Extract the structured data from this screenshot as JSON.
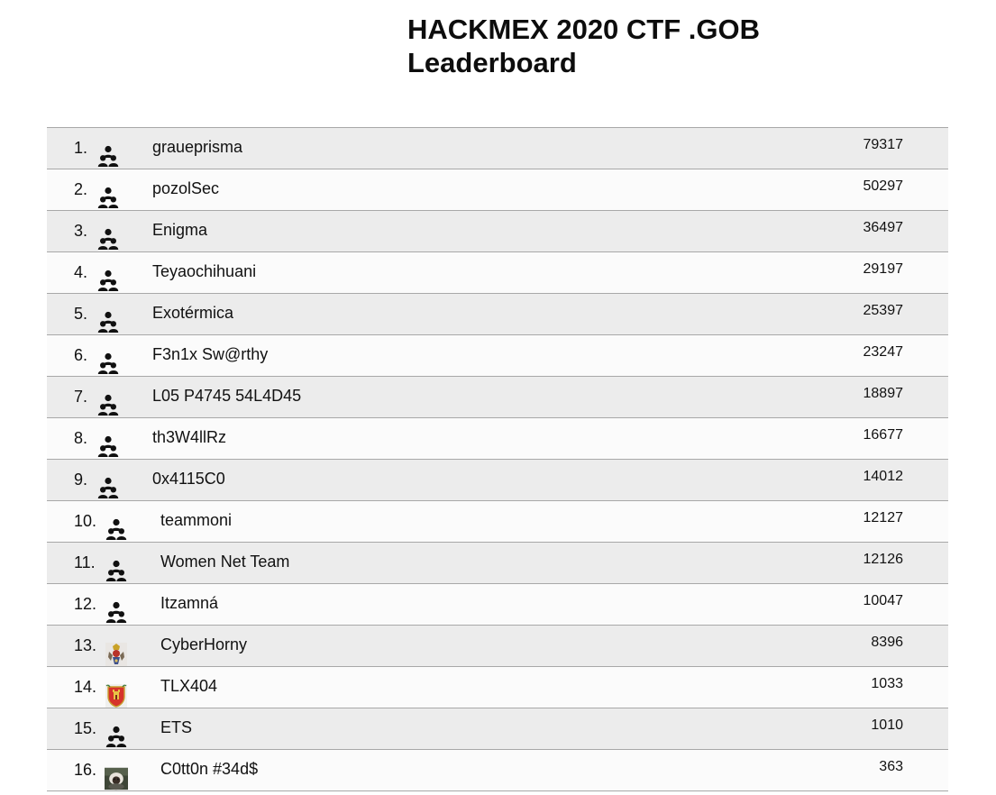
{
  "page": {
    "title_line1": "HACKMEX 2020 CTF .GOB",
    "title_line2": "Leaderboard"
  },
  "leaderboard": {
    "rows": [
      {
        "rank": "1.",
        "name": "graueprisma",
        "score": "79317",
        "avatar": "group-icon"
      },
      {
        "rank": "2.",
        "name": "pozolSec",
        "score": "50297",
        "avatar": "group-icon"
      },
      {
        "rank": "3.",
        "name": "Enigma",
        "score": "36497",
        "avatar": "group-icon"
      },
      {
        "rank": "4.",
        "name": "Teyaochihuani",
        "score": "29197",
        "avatar": "group-icon"
      },
      {
        "rank": "5.",
        "name": "Exotérmica",
        "score": "25397",
        "avatar": "group-icon"
      },
      {
        "rank": "6.",
        "name": "F3n1x Sw@rthy",
        "score": "23247",
        "avatar": "group-icon"
      },
      {
        "rank": "7.",
        "name": "L05 P4745 54L4D45",
        "score": "18897",
        "avatar": "group-icon"
      },
      {
        "rank": "8.",
        "name": "th3W4llRz",
        "score": "16677",
        "avatar": "group-icon"
      },
      {
        "rank": "9.",
        "name": "0x4115C0",
        "score": "14012",
        "avatar": "group-icon"
      },
      {
        "rank": "10.",
        "name": "teammoni",
        "score": "12127",
        "avatar": "group-icon"
      },
      {
        "rank": "11.",
        "name": "Women Net Team",
        "score": "12126",
        "avatar": "group-icon"
      },
      {
        "rank": "12.",
        "name": "Itzamná",
        "score": "10047",
        "avatar": "group-icon"
      },
      {
        "rank": "13.",
        "name": "CyberHorny",
        "score": "8396",
        "avatar": "crest-image"
      },
      {
        "rank": "14.",
        "name": "TLX404",
        "score": "1033",
        "avatar": "shield-crest-image"
      },
      {
        "rank": "15.",
        "name": "ETS",
        "score": "1010",
        "avatar": "group-icon"
      },
      {
        "rank": "16.",
        "name": "C0tt0n #34d$",
        "score": "363",
        "avatar": "monkey-photo"
      }
    ]
  },
  "colors": {
    "row_shaded": "#ececec",
    "row_light": "#fbfbfb",
    "divider": "#a8a8a8",
    "text": "#111111"
  }
}
